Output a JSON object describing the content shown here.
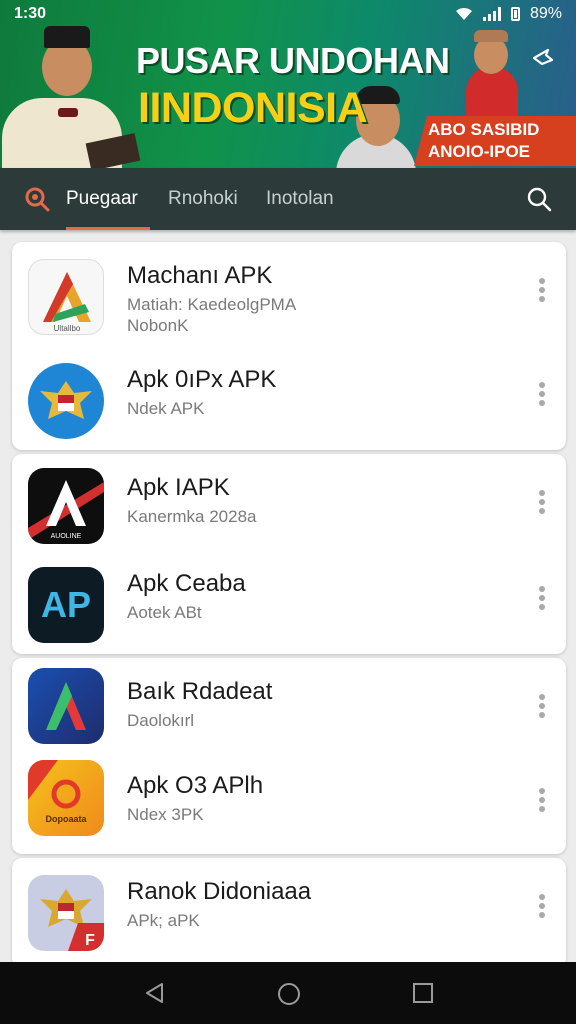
{
  "status": {
    "time": "1:30",
    "battery": "89%"
  },
  "banner": {
    "title_line1": "PUSAR UNDOHAN",
    "title_line2": "IINDONISIA",
    "promo_line1": "ABO SASIBID",
    "promo_line2": "ANOIO-IPOE"
  },
  "tabs": [
    {
      "label": "Puegaar"
    },
    {
      "label": "Rnohoki"
    },
    {
      "label": "Inotolan"
    }
  ],
  "apps": [
    {
      "name": "Machanı APK",
      "sub1": "Matiah: KaedeolgPMA",
      "sub2": "NobonK",
      "icon": "triangle-a-logo"
    },
    {
      "name": "Apk 0ıPx APK",
      "sub1": "Ndek APK",
      "sub2": "",
      "icon": "garuda-emblem"
    },
    {
      "name": "Apk IAPK",
      "sub1": "Kanermka 2028a",
      "sub2": "",
      "icon": "black-a-logo"
    },
    {
      "name": "Apk Ceaba",
      "sub1": "Aotek ABt",
      "sub2": "",
      "icon": "ap-logo"
    },
    {
      "name": "Baık Rdadeat",
      "sub1": "Daolokırl",
      "sub2": "",
      "icon": "gradient-a-logo"
    },
    {
      "name": "Apk O3 APlh",
      "sub1": "Ndex 3PK",
      "sub2": "",
      "icon": "orange-app-logo"
    },
    {
      "name": "Ranok Didoniaaa",
      "sub1": "APk; aPK",
      "sub2": "",
      "icon": "garuda-flag-emblem"
    }
  ],
  "icon_texts": {
    "app1": "Ultallbo",
    "app3": "AUOLINE",
    "app6": "Dopoaata"
  },
  "colors": {
    "tabbar": "#2d3a3a",
    "accent": "#e36b4b",
    "banner_green": "#11924a",
    "title_yellow": "#f5d016"
  }
}
